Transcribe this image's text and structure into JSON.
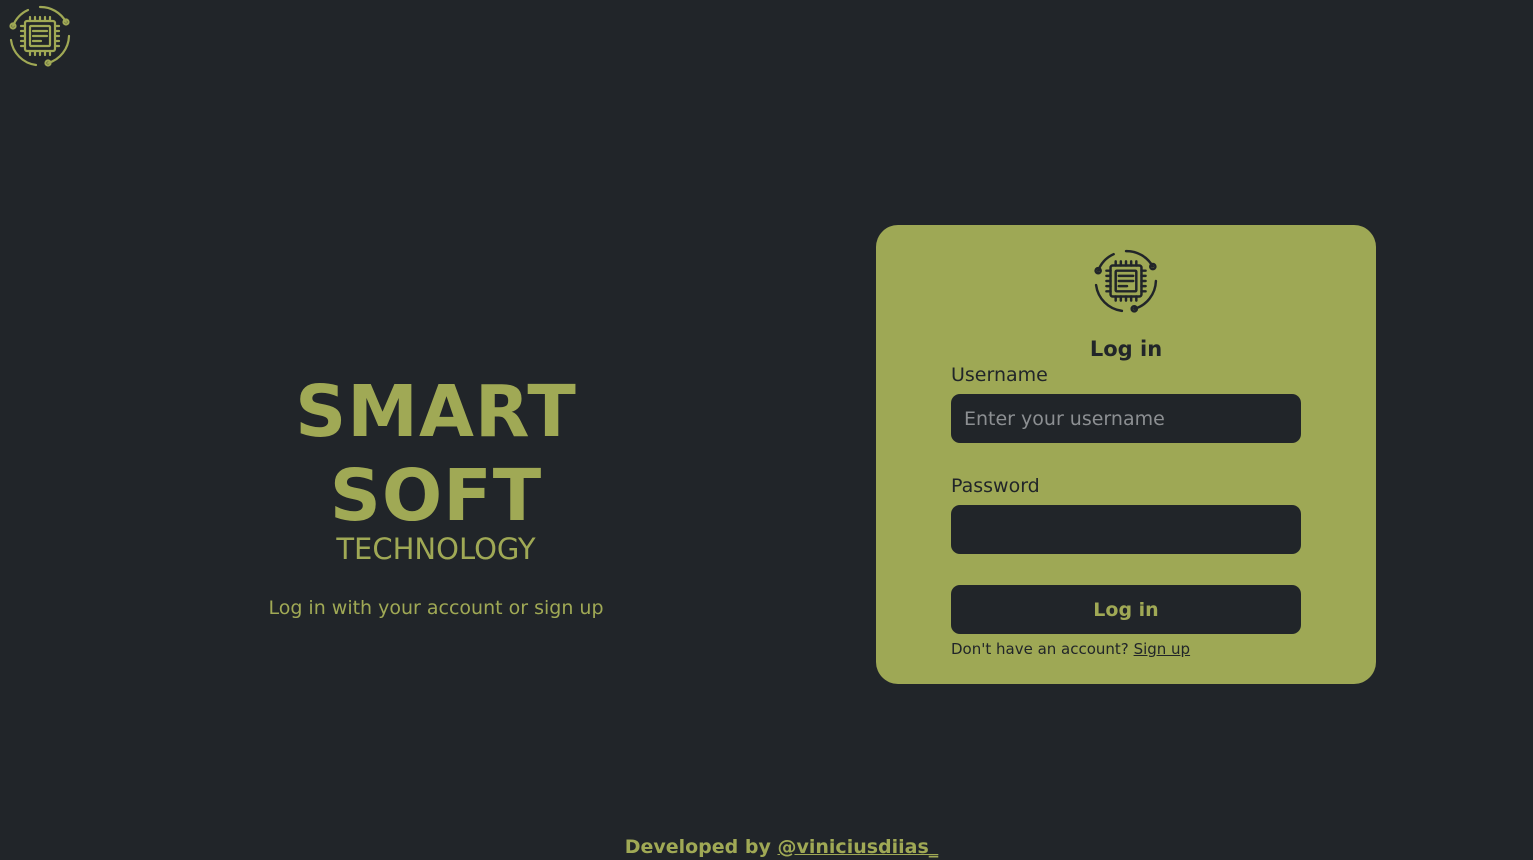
{
  "colors": {
    "background": "#212529",
    "accent": "#a0a955",
    "card": "#9ea855"
  },
  "icons": {
    "corner_logo": "chip-logo-icon",
    "card_logo": "chip-logo-icon"
  },
  "hero": {
    "title": "SMART SOFT",
    "subtitle": "TECHNOLOGY",
    "tagline": "Log in with your account or sign up"
  },
  "login_card": {
    "title": "Log in",
    "username_label": "Username",
    "username_placeholder": "Enter your username",
    "username_value": "",
    "password_label": "Password",
    "password_value": "",
    "submit_label": "Log in",
    "signup_prompt": "Don't have an account?",
    "signup_link": "Sign up"
  },
  "footer": {
    "prefix": "Developed by",
    "author_link": "@viniciusdiias_"
  }
}
